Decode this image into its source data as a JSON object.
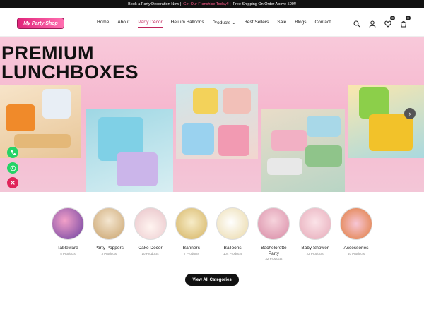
{
  "topbar": {
    "part1": "Book a Party Decoration Now |",
    "part2": "Get Our Franchise Today!! |",
    "part3": "Free Shipping On Order Above 500!!"
  },
  "header": {
    "logo_text": "My Party Shop",
    "nav": [
      "Home",
      "About",
      "Party Décor",
      "Helium Balloons",
      "Products ⌄",
      "Best Sellers",
      "Sale",
      "Blogs",
      "Contact"
    ],
    "active_nav": "Party Décor",
    "wishlist_count": "0",
    "cart_count": "0"
  },
  "hero": {
    "title_line1": "PREMIUM",
    "title_line2": "LUNCHBOXES",
    "next_arrow": "›"
  },
  "categories": [
    {
      "name": "Tableware",
      "count": "5 Products",
      "color": "#6b3fa0"
    },
    {
      "name": "Party Poppers",
      "count": "3 Products",
      "color": "#c9a26b"
    },
    {
      "name": "Cake Decor",
      "count": "10 Products",
      "color": "#e8c2c8"
    },
    {
      "name": "Banners",
      "count": "7 Products",
      "color": "#d4b25f"
    },
    {
      "name": "Balloons",
      "count": "104 Products",
      "color": "#e9d7a4"
    },
    {
      "name": "Bachelorette Party",
      "count": "32 Products",
      "color": "#d88aa5"
    },
    {
      "name": "Baby Shower",
      "count": "22 Products",
      "color": "#e6a9b8"
    },
    {
      "name": "Accessories",
      "count": "40 Products",
      "color": "#e07a3a"
    }
  ],
  "view_all_label": "View All Categories"
}
